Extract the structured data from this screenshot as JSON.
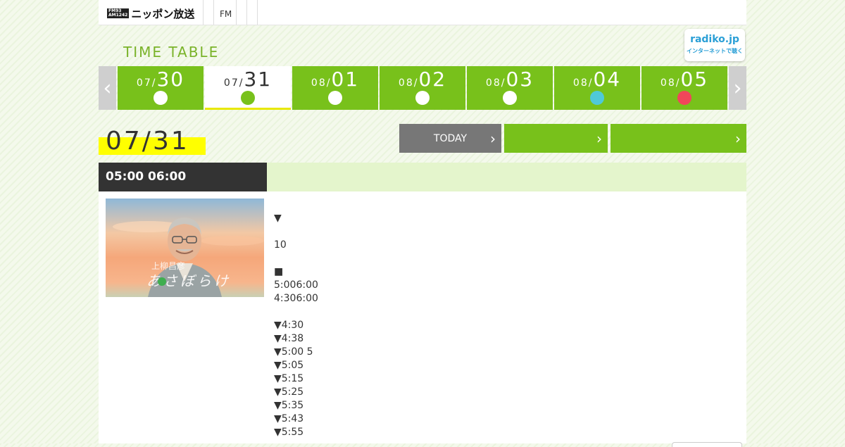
{
  "header": {
    "logo_badge_line1": "FM93",
    "logo_badge_line2": "AM1242",
    "logo_text": "ニッポン放送",
    "nav_fm": "FM"
  },
  "timetable_title": "TIME TABLE",
  "radiko": {
    "main": "radiko.jp",
    "sub": "インターネットで聴く"
  },
  "date_tabs": [
    {
      "month": "07/",
      "day": "30",
      "dot_color": "#ffffff",
      "active": false
    },
    {
      "month": "07/",
      "day": "31",
      "dot_color": "#78c11b",
      "active": true
    },
    {
      "month": "08/",
      "day": "01",
      "dot_color": "#ffffff",
      "active": false
    },
    {
      "month": "08/",
      "day": "02",
      "dot_color": "#ffffff",
      "active": false
    },
    {
      "month": "08/",
      "day": "03",
      "dot_color": "#ffffff",
      "active": false
    },
    {
      "month": "08/",
      "day": "04",
      "dot_color": "#4fc9d8",
      "active": false
    },
    {
      "month": "08/",
      "day": "05",
      "dot_color": "#f0465a",
      "active": false
    }
  ],
  "nav": {
    "prev_icon": "chevron-left-icon",
    "next_icon": "chevron-right-icon",
    "prev_glyph": "‹",
    "next_glyph": "›"
  },
  "current_date": "07/31",
  "buttons": {
    "today_label": "TODAY",
    "chevron": "›"
  },
  "colors": {
    "accent_green": "#78c11b",
    "today_gray": "#777777",
    "highlight_yellow": "#ffff00",
    "time_bar_dark": "#333333"
  },
  "program": {
    "time": "05:00  06:00",
    "image_caption_1": "上柳昌彦",
    "image_caption_2": "あさぼらけ",
    "lines": [
      "▼",
      "",
      " 10",
      "",
      "■",
      "5:006:00",
      "4:306:00",
      "",
      "▼4:30",
      "▼4:38",
      "▼5:00 5",
      "▼5:05",
      "▼5:15",
      "▼5:25",
      "▼5:35",
      "▼5:43",
      "▼5:55"
    ]
  }
}
